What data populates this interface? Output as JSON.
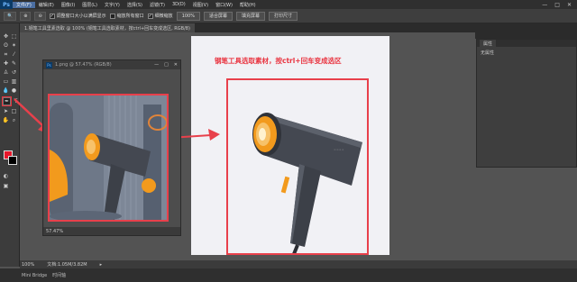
{
  "app": {
    "logo": "Ps",
    "menu": [
      "文件(F)",
      "编辑(E)",
      "图像(I)",
      "图层(L)",
      "文字(Y)",
      "选择(S)",
      "滤镜(T)",
      "3D(D)",
      "视图(V)",
      "窗口(W)",
      "帮助(H)"
    ],
    "window_controls": [
      "—",
      "□",
      "✕"
    ]
  },
  "options_bar": {
    "checks": [
      {
        "label": "调整窗口大小以满屏显示",
        "checked": true
      },
      {
        "label": "缩放所有窗口",
        "checked": false
      },
      {
        "label": "细微缩放",
        "checked": true
      }
    ],
    "buttons": [
      "100%",
      "适合屏幕",
      "填充屏幕",
      "打印尺寸"
    ]
  },
  "doc_tabs": [
    {
      "label": "1.钢笔工具里素选取 @ 100% (钢笔工具选取素材，按ctrl+回车变成选区, RGB/8)",
      "active": true
    }
  ],
  "float_window": {
    "title": "1.png @ 57.47% (RGB/8)",
    "status": "57.47%"
  },
  "canvas": {
    "instruction": "钢笔工具选取素材，按ctrl+回车变成选区"
  },
  "properties_panel": {
    "tab": "属性",
    "content": "无属性"
  },
  "status_bar": {
    "zoom": "100%",
    "doc_info": "文档:1.05M/3.82M"
  },
  "bottom_bar": {
    "tabs": [
      "Mini Bridge",
      "时间轴"
    ]
  },
  "colors": {
    "foreground": "#e8172b",
    "background": "#000000",
    "annotation_red": "#e8404b",
    "accent_orange": "#f29a1d"
  }
}
